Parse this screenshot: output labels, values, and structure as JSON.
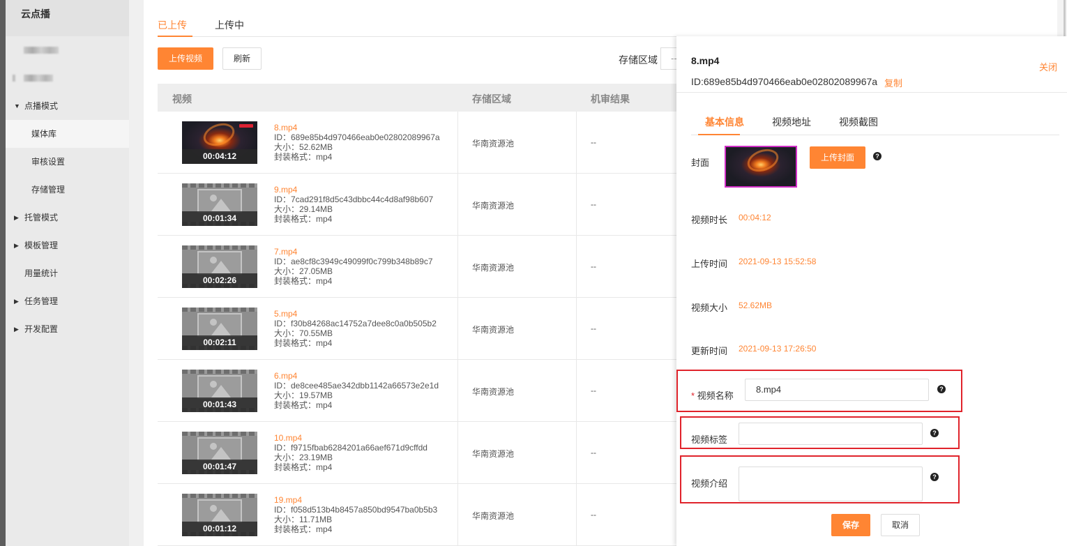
{
  "sidebar": {
    "title": "云点播",
    "items": [
      {
        "label": "点播模式",
        "expand": "▼"
      },
      {
        "label": "媒体库"
      },
      {
        "label": "审核设置"
      },
      {
        "label": "存储管理"
      },
      {
        "label": "托管模式",
        "expand": "▶"
      },
      {
        "label": "模板管理",
        "expand": "▶"
      },
      {
        "label": "用量统计"
      },
      {
        "label": "任务管理",
        "expand": "▶"
      },
      {
        "label": "开发配置",
        "expand": "▶"
      }
    ]
  },
  "tabs": {
    "uploaded": "已上传",
    "uploading": "上传中"
  },
  "toolbar": {
    "upload": "上传视频",
    "refresh": "刷新",
    "storage_label": "存储区域",
    "storage_value": "--"
  },
  "table": {
    "headers": {
      "video": "视频",
      "region": "存储区域",
      "review": "机审结果"
    },
    "rows": [
      {
        "name": "8.mp4",
        "id": "ID：689e85b4d970466eab0e02802089967a",
        "size": "大小：52.62MB",
        "format": "封装格式：mp4",
        "duration": "00:04:12",
        "region": "华南资源池",
        "review": "--"
      },
      {
        "name": "9.mp4",
        "id": "ID：7cad291f8d5c43dbbc44c4d8af98b607",
        "size": "大小：29.14MB",
        "format": "封装格式：mp4",
        "duration": "00:01:34",
        "region": "华南资源池",
        "review": "--"
      },
      {
        "name": "7.mp4",
        "id": "ID：ae8cf8c3949c49099f0c799b348b89c7",
        "size": "大小：27.05MB",
        "format": "封装格式：mp4",
        "duration": "00:02:26",
        "region": "华南资源池",
        "review": "--"
      },
      {
        "name": "5.mp4",
        "id": "ID：f30b84268ac14752a7dee8c0a0b505b2",
        "size": "大小：70.55MB",
        "format": "封装格式：mp4",
        "duration": "00:02:11",
        "region": "华南资源池",
        "review": "--"
      },
      {
        "name": "6.mp4",
        "id": "ID：de8cee485ae342dbb1142a66573e2e1d",
        "size": "大小：19.57MB",
        "format": "封装格式：mp4",
        "duration": "00:01:43",
        "region": "华南资源池",
        "review": "--"
      },
      {
        "name": "10.mp4",
        "id": "ID：f9715fbab6284201a66aef671d9cffdd",
        "size": "大小：23.19MB",
        "format": "封装格式：mp4",
        "duration": "00:01:47",
        "region": "华南资源池",
        "review": "--"
      },
      {
        "name": "19.mp4",
        "id": "ID：f058d513b4b8457a850bd9547ba0b5b3",
        "size": "大小：11.71MB",
        "format": "封装格式：mp4",
        "duration": "00:01:12",
        "region": "华南资源池",
        "review": "--"
      }
    ]
  },
  "panel": {
    "title": "8.mp4",
    "close": "关闭",
    "id": "ID:689e85b4d970466eab0e02802089967a",
    "copy": "复制",
    "tabs": [
      "基本信息",
      "视频地址",
      "视频截图"
    ],
    "cover_label": "封面",
    "cover_button": "上传封面",
    "help": "?",
    "duration_label": "视频时长",
    "duration": "00:04:12",
    "upload_time_label": "上传时间",
    "upload_time": "2021-09-13 15:52:58",
    "size_label": "视频大小",
    "size": "52.62MB",
    "update_time_label": "更新时间",
    "update_time": "2021-09-13 17:26:50",
    "required_mark": "*",
    "name_label": "视频名称",
    "name_value": "8.mp4",
    "tags_label": "视频标签",
    "tags_value": "",
    "intro_label": "视频介绍",
    "intro_value": "",
    "save": "保存",
    "cancel": "取消"
  },
  "colors": {
    "accent": "#ff8533",
    "highlight_box": "#e0232b"
  }
}
